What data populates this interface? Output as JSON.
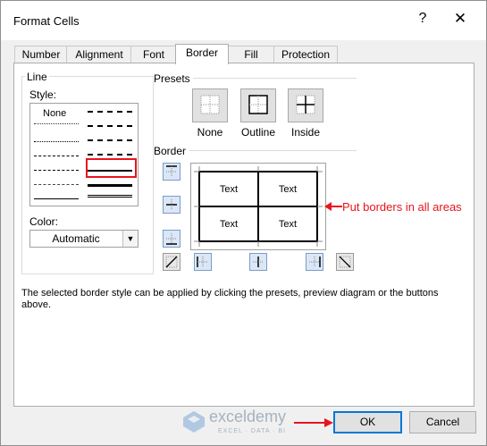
{
  "dialog": {
    "title": "Format Cells",
    "help_icon": "?",
    "close_icon": "✕"
  },
  "tabs": [
    {
      "label": "Number"
    },
    {
      "label": "Alignment"
    },
    {
      "label": "Font"
    },
    {
      "label": "Border",
      "active": true
    },
    {
      "label": "Fill"
    },
    {
      "label": "Protection"
    }
  ],
  "line_group": {
    "title": "Line",
    "style_label": "Style:",
    "none_option": "None",
    "color_label": "Color:",
    "color_value": "Automatic"
  },
  "presets": {
    "title": "Presets",
    "items": [
      {
        "label": "None"
      },
      {
        "label": "Outline"
      },
      {
        "label": "Inside"
      }
    ]
  },
  "border_section": {
    "title": "Border",
    "preview_cells": [
      "Text",
      "Text",
      "Text",
      "Text"
    ]
  },
  "annotation": {
    "text": "Put borders in all areas",
    "color": "#e8141c"
  },
  "description": "The selected border style can be applied by clicking the presets, preview diagram or the buttons above.",
  "watermark": {
    "name": "exceldemy",
    "tagline": "EXCEL · DATA · BI"
  },
  "buttons": {
    "ok": "OK",
    "cancel": "Cancel"
  },
  "colors": {
    "accent": "#0078d7",
    "highlight": "#e8141c"
  }
}
